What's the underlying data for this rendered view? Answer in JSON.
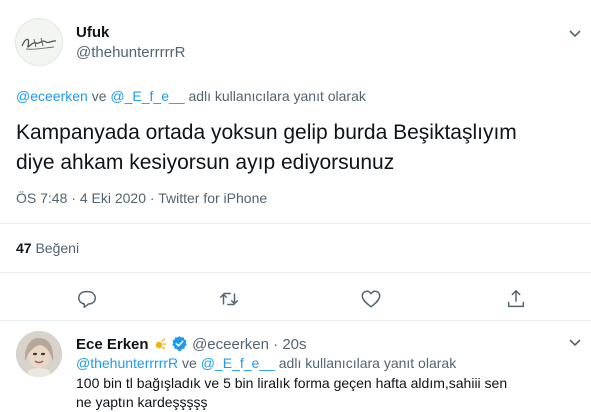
{
  "tweet": {
    "author_name": "Ufuk",
    "author_handle": "@thehunterrrrrR",
    "reply_to": {
      "mention_1": "@eceerken",
      "conj": "ve",
      "mention_2": "@_E_f_e__",
      "suffix": "adlı kullanıcılara yanıt olarak"
    },
    "text_line_1": "Kampanyada ortada yoksun gelip burda Beşiktaşlıyım",
    "text_line_2": "diye ahkam kesiyorsun ayıp ediyorsunuz",
    "time": "ÖS 7:48",
    "separator": "·",
    "date": "4 Eki 2020",
    "source": "Twitter for iPhone",
    "likes_count": "47",
    "likes_label": "Beğeni"
  },
  "reply": {
    "author_name": "Ece Erken",
    "author_handle": "@eceerken",
    "separator": "·",
    "time": "20s",
    "reply_to": {
      "mention_1": "@thehunterrrrrR",
      "conj": "ve",
      "mention_2": "@_E_f_e__",
      "suffix": "adlı kullanıcılara yanıt olarak"
    },
    "text": "100 bin tl bağışladık ve 5 bin liralık forma geçen hafta aldım,sahiii sen ne yaptın kardeşşşşş"
  },
  "icons": {
    "more": "chevron-down-icon",
    "reply": "reply-icon",
    "retweet": "retweet-icon",
    "like": "heart-icon",
    "share": "share-icon",
    "verified": "verified-badge-icon"
  },
  "colors": {
    "accent": "#1d9bf0",
    "secondary_text": "#536471",
    "divider": "#e6ecf0"
  }
}
